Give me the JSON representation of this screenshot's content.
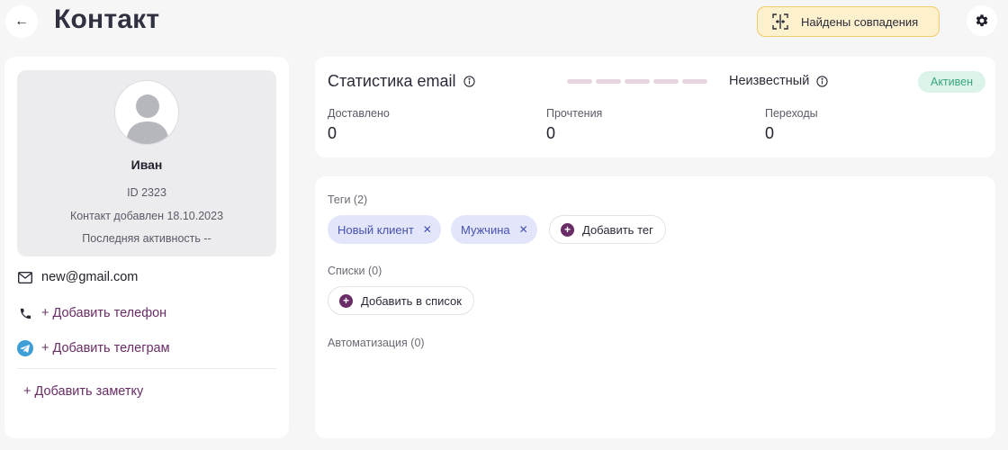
{
  "header": {
    "back_icon": "arrow-left-icon",
    "title": "Контакт",
    "matches_button": {
      "icon": "frame-compare-icon",
      "label": "Найдены совпадения"
    },
    "settings_icon": "gear-icon"
  },
  "profile": {
    "name": "Иван",
    "id": "ID 2323",
    "added": "Контакт добавлен 18.10.2023",
    "last_activity": "Последняя активность --"
  },
  "contacts": {
    "email": "new@gmail.com",
    "add_phone": "+ Добавить телефон",
    "add_telegram": "+ Добавить телеграм",
    "add_note": "+ Добавить заметку"
  },
  "email_stats": {
    "title": "Статистика email",
    "status_label": "Неизвестный",
    "badge": "Активен",
    "items": [
      {
        "label": "Доставлено",
        "value": "0"
      },
      {
        "label": "Прочтения",
        "value": "0"
      },
      {
        "label": "Переходы",
        "value": "0"
      }
    ]
  },
  "tags": {
    "label": "Теги (2)",
    "items": [
      "Новый клиент",
      "Мужчина"
    ],
    "add_label": "Добавить тег"
  },
  "lists": {
    "label": "Списки (0)",
    "add_label": "Добавить в список"
  },
  "automation": {
    "label": "Автоматизация (0)"
  },
  "colors": {
    "accent": "#6a2c66",
    "warning_bg": "#fdf0cd",
    "warning_border": "#f2cc6b",
    "tag_bg": "#e3e6fb",
    "tag_text": "#4752b0",
    "badge_bg": "#dcf3ea",
    "badge_text": "#3aa57e",
    "telegram": "#3e9ed8"
  }
}
